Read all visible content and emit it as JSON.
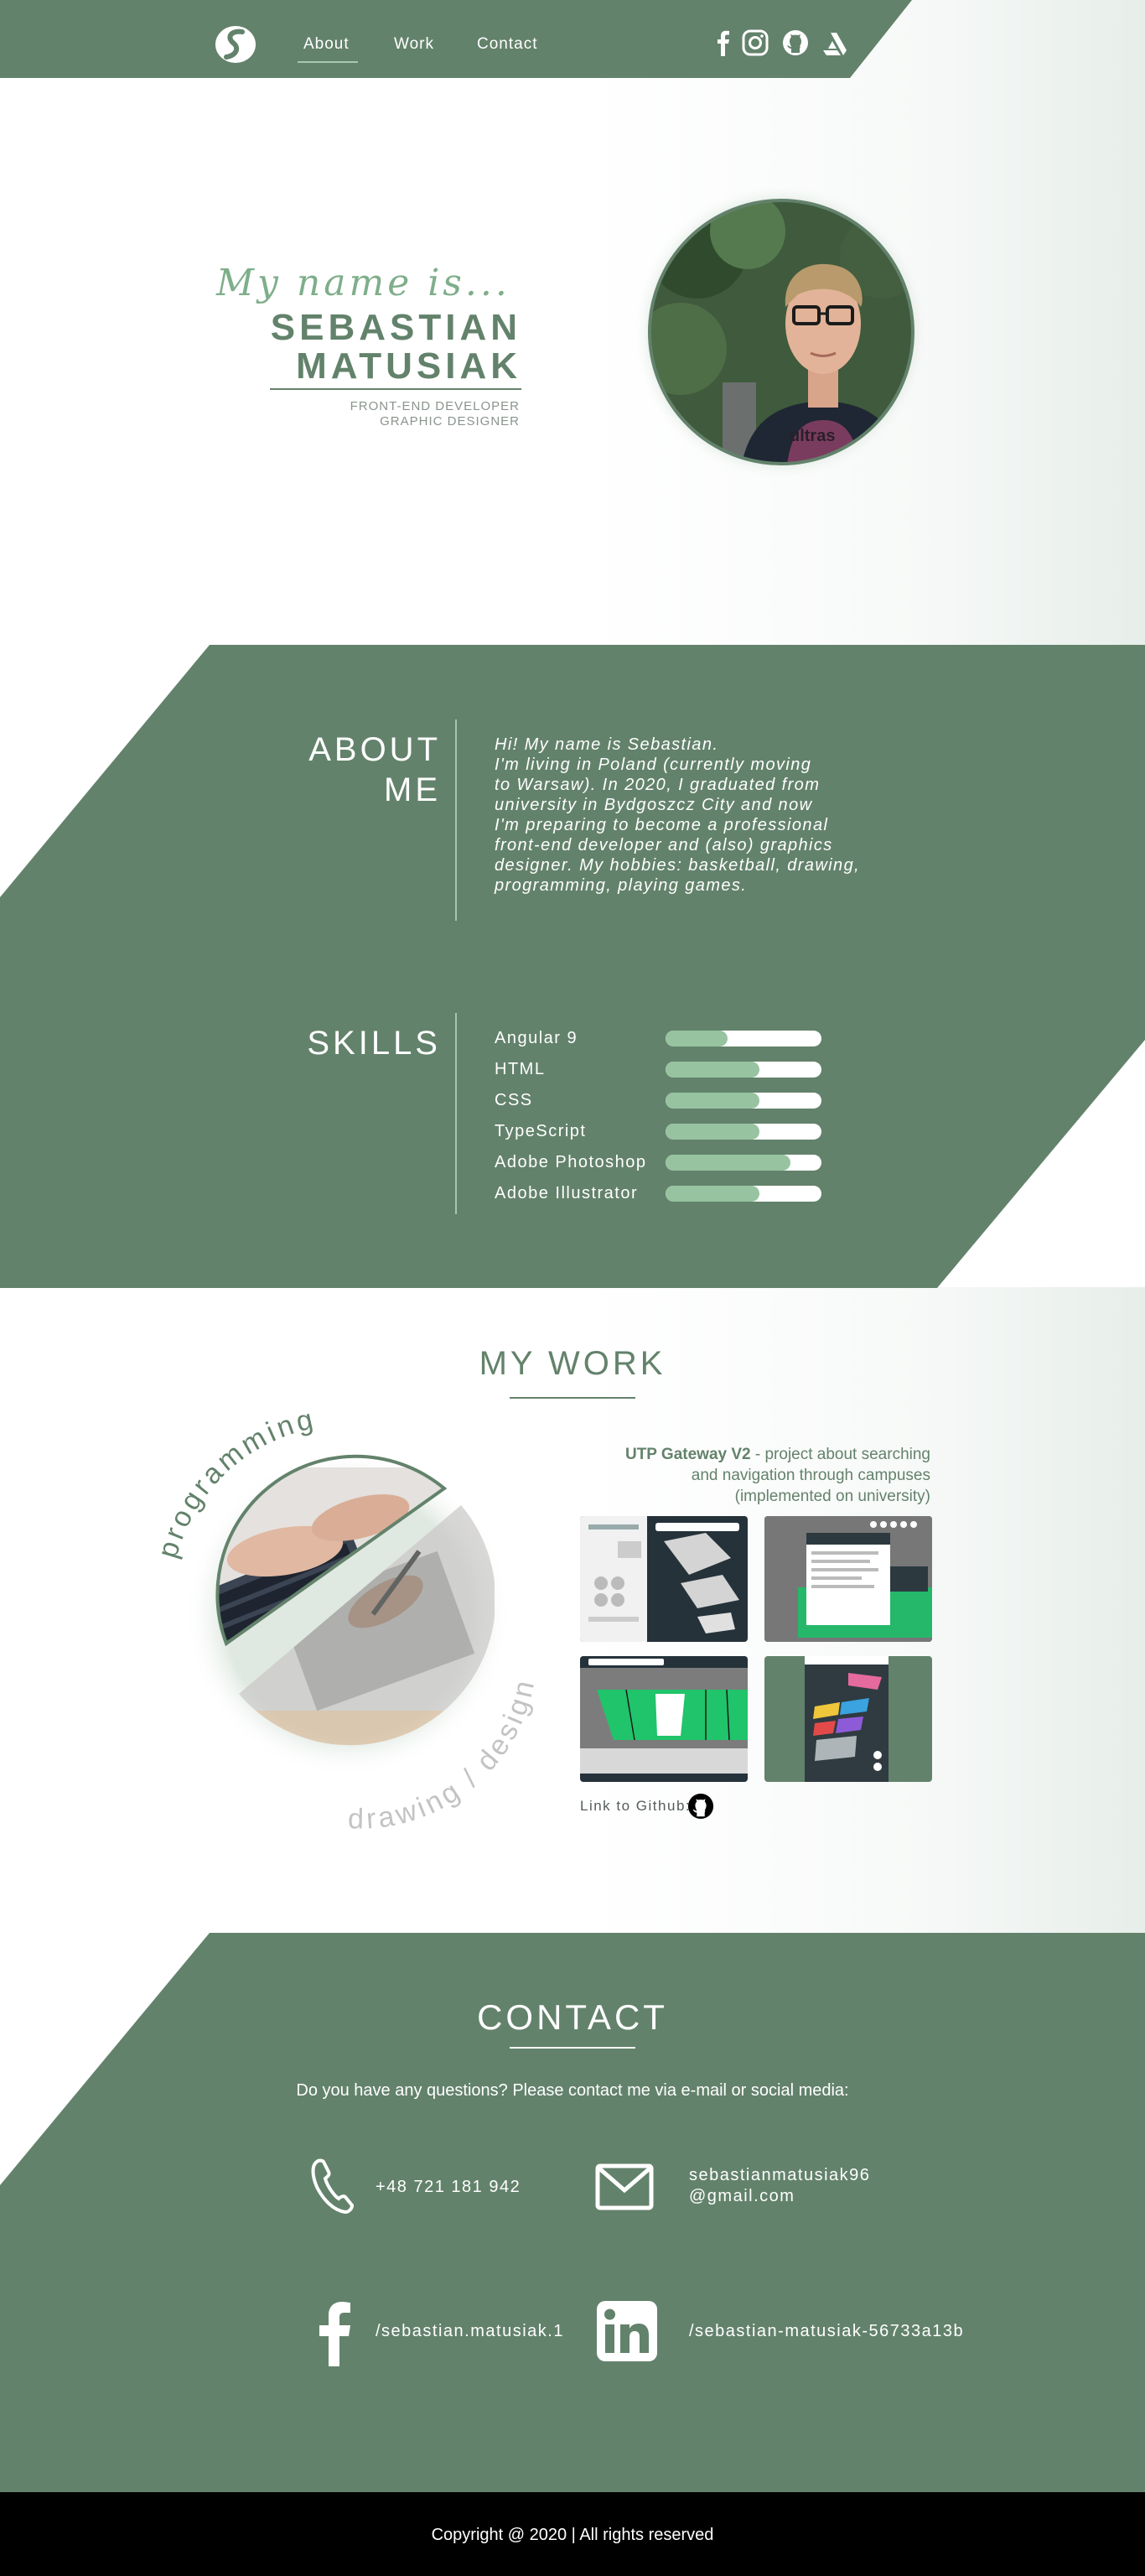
{
  "nav": {
    "items": [
      {
        "label": "About"
      },
      {
        "label": "Work"
      },
      {
        "label": "Contact"
      }
    ],
    "social_icons": [
      "facebook-icon",
      "instagram-icon",
      "github-icon",
      "artstation-icon"
    ]
  },
  "hero": {
    "greeting": "My name is...",
    "first_name": "SEBASTIAN",
    "last_name": "MATUSIAK",
    "roles": [
      "FRONT-END DEVELOPER",
      "GRAPHIC DESIGNER"
    ]
  },
  "about": {
    "title_line1": "ABOUT",
    "title_line2": "ME",
    "text": "Hi! My name is Sebastian.\nI'm living in Poland (currently moving\nto Warsaw). In 2020, I graduated from\nuniversity in Bydgoszcz City and now\nI'm preparing to become a professional\nfront-end developer and (also) graphics\ndesigner. My hobbies: basketball, drawing,\nprogramming, playing games."
  },
  "skills": {
    "title": "SKILLS",
    "items": [
      {
        "label": "Angular 9",
        "level": 0.4
      },
      {
        "label": "HTML",
        "level": 0.6
      },
      {
        "label": "CSS",
        "level": 0.6
      },
      {
        "label": "TypeScript",
        "level": 0.6
      },
      {
        "label": "Adobe Photoshop",
        "level": 0.8
      },
      {
        "label": "Adobe Illustrator",
        "level": 0.6
      }
    ]
  },
  "work": {
    "title": "MY WORK",
    "circle_label_top": "programming",
    "circle_label_bottom": "drawing / design",
    "project_name": "UTP Gateway V2",
    "project_desc_line1": " - project about searching",
    "project_desc_line2": "and navigation through campuses",
    "project_desc_line3": "(implemented on university)",
    "github_link": "Link to Github:"
  },
  "contact": {
    "title": "CONTACT",
    "intro": "Do you have any questions? Please contact me via e-mail or social media:",
    "phone": "+48 721 181 942",
    "email_line1": "sebastianmatusiak96",
    "email_line2": "@gmail.com",
    "facebook": "/sebastian.matusiak.1",
    "linkedin": "/sebastian-matusiak-56733a13b"
  },
  "footer": {
    "text": "Copyright @ 2020  |  All rights reserved"
  },
  "colors": {
    "primary": "#63826b",
    "accent_light": "#97c3a0",
    "footer": "#000000"
  }
}
